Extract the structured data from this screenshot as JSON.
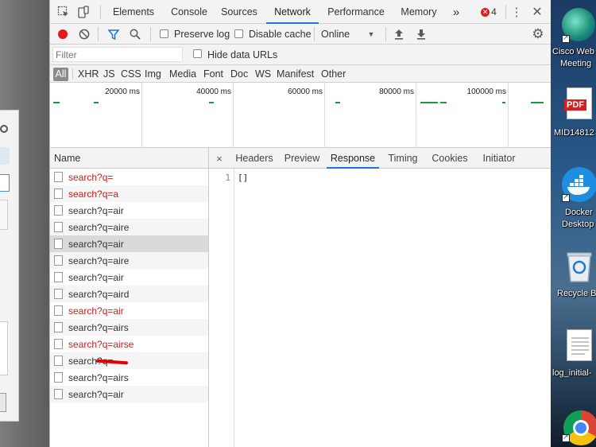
{
  "devtools": {
    "tabs": [
      "Elements",
      "Console",
      "Sources",
      "Network",
      "Performance",
      "Memory"
    ],
    "active_tab": "Network",
    "more_tabs_glyph": "»",
    "error_count": "4",
    "icons": {
      "inspect": "inspect-element-icon",
      "device": "device-toolbar-icon",
      "error": "error-badge-icon",
      "menu": "kebab-menu-icon",
      "close": "close-icon"
    },
    "colors": {
      "accent": "#1a73e8",
      "error": "#d11a1a",
      "record": "#e01b1b",
      "filter": "#1a73e8"
    }
  },
  "network_toolbar": {
    "preserve_log": "Preserve log",
    "disable_cache": "Disable cache",
    "throttling": "Online",
    "preserve_checked": false,
    "disable_cache_checked": false
  },
  "filter_bar": {
    "placeholder": "Filter",
    "hide_data_urls": "Hide data URLs",
    "types": [
      "All",
      "XHR",
      "JS",
      "CSS",
      "Img",
      "Media",
      "Font",
      "Doc",
      "WS",
      "Manifest",
      "Other"
    ],
    "active_type": "All"
  },
  "overview": {
    "ticks": [
      "20000 ms",
      "40000 ms",
      "60000 ms",
      "80000 ms",
      "100000 ms"
    ]
  },
  "requests": {
    "column_header": "Name",
    "items": [
      {
        "name": "search?q=",
        "status": "error"
      },
      {
        "name": "search?q=a",
        "status": "error"
      },
      {
        "name": "search?q=air",
        "status": "ok"
      },
      {
        "name": "search?q=aire",
        "status": "ok"
      },
      {
        "name": "search?q=air",
        "status": "ok",
        "selected": true
      },
      {
        "name": "search?q=aire",
        "status": "ok"
      },
      {
        "name": "search?q=air",
        "status": "ok"
      },
      {
        "name": "search?q=aird",
        "status": "ok"
      },
      {
        "name": "search?q=air",
        "status": "error"
      },
      {
        "name": "search?q=airs",
        "status": "ok"
      },
      {
        "name": "search?q=airse",
        "status": "error"
      },
      {
        "name": "search?q=",
        "status": "ok",
        "redacted": true
      },
      {
        "name": "search?q=airs",
        "status": "ok"
      },
      {
        "name": "search?q=air",
        "status": "ok"
      }
    ]
  },
  "detail": {
    "close_glyph": "×",
    "tabs": [
      "Headers",
      "Preview",
      "Response",
      "Timing",
      "Cookies",
      "Initiator"
    ],
    "active_tab": "Response",
    "response": {
      "line_number": "1",
      "content": "[]"
    }
  },
  "desktop": {
    "icons": [
      {
        "label_lines": [
          "Cisco Web",
          "Meeting"
        ],
        "icon": "webex-icon"
      },
      {
        "label_lines": [
          "MID14812"
        ],
        "icon": "pdf-icon",
        "badge": "PDF"
      },
      {
        "label_lines": [
          "Docker",
          "Desktop"
        ],
        "icon": "docker-icon"
      },
      {
        "label_lines": [
          "Recycle B"
        ],
        "icon": "recycle-bin-icon"
      },
      {
        "label_lines": [
          "log_initial-"
        ],
        "icon": "text-file-icon"
      },
      {
        "label_lines": [],
        "icon": "chrome-icon"
      }
    ]
  }
}
